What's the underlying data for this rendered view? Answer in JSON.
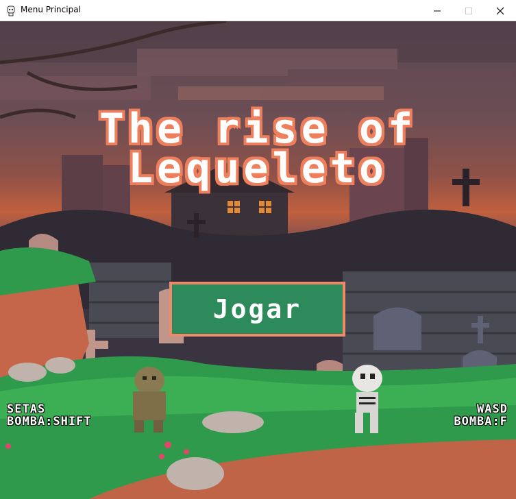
{
  "window": {
    "title": "Menu Principal"
  },
  "game": {
    "title_line1": "The rise of",
    "title_line2": "Lequeleto",
    "play_button": "Jogar",
    "player1_controls": {
      "move": "SETAS",
      "bomb": "BOMBA:SHIFT"
    },
    "player2_controls": {
      "move": "WASD",
      "bomb": "BOMBA:F"
    }
  },
  "colors": {
    "title_outline": "#ee7f5c",
    "button_fill": "#2d8a5a",
    "button_border": "#ee8a6a",
    "grass": "#2f9a4c"
  }
}
